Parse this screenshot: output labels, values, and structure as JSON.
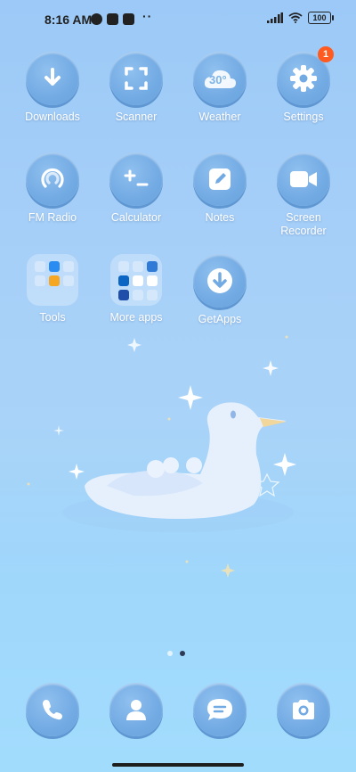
{
  "status": {
    "time": "8:16 AM",
    "dots": "··",
    "battery": "100"
  },
  "apps": [
    {
      "label": "Downloads",
      "icon": "download-icon"
    },
    {
      "label": "Scanner",
      "icon": "scanner-icon"
    },
    {
      "label": "Weather",
      "icon": "weather-icon",
      "temp": "30°"
    },
    {
      "label": "Settings",
      "icon": "gear-icon",
      "badge": "1"
    },
    {
      "label": "FM Radio",
      "icon": "radio-icon"
    },
    {
      "label": "Calculator",
      "icon": "calculator-icon"
    },
    {
      "label": "Notes",
      "icon": "notes-icon"
    },
    {
      "label": "Screen Recorder",
      "icon": "video-camera-icon"
    },
    {
      "label": "Tools",
      "icon": "folder-icon"
    },
    {
      "label": "More apps",
      "icon": "folder-icon"
    },
    {
      "label": "GetApps",
      "icon": "getapps-icon"
    }
  ],
  "dock": [
    {
      "name": "phone",
      "icon": "phone-icon"
    },
    {
      "name": "contacts",
      "icon": "contacts-icon"
    },
    {
      "name": "messages",
      "icon": "messages-icon"
    },
    {
      "name": "camera",
      "icon": "camera-icon"
    }
  ],
  "pager": {
    "pages": 2,
    "current": 2
  },
  "colors": {
    "icon_bg": "#72aae3",
    "badge": "#ff5a1f",
    "label": "#ffffff"
  }
}
